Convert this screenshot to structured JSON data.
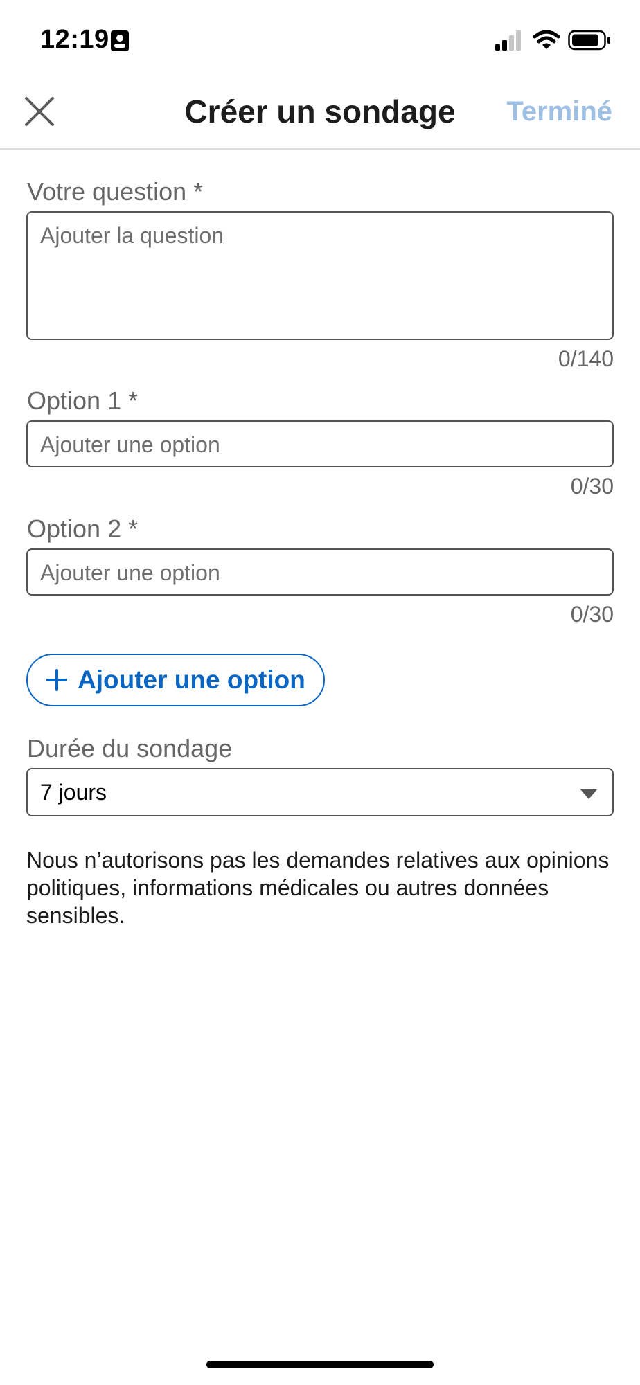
{
  "status_bar": {
    "time": "12:19"
  },
  "header": {
    "title": "Créer un sondage",
    "done_label": "Terminé"
  },
  "question": {
    "label": "Votre question *",
    "placeholder": "Ajouter la question",
    "counter": "0/140"
  },
  "options": [
    {
      "label": "Option 1 *",
      "placeholder": "Ajouter une option",
      "counter": "0/30"
    },
    {
      "label": "Option 2 *",
      "placeholder": "Ajouter une option",
      "counter": "0/30"
    }
  ],
  "add_option_label": "Ajouter une option",
  "duration": {
    "label": "Durée du sondage",
    "value": "7 jours"
  },
  "disclaimer": "Nous n’autorisons pas les demandes relatives aux opinions politiques, informations médicales ou autres données sensibles.",
  "colors": {
    "accent": "#0a66c2",
    "done_disabled": "#9dbfe3",
    "label_gray": "#666666",
    "border": "#555555"
  },
  "icons": {
    "close": "close-icon",
    "add": "plus-icon",
    "dropdown": "caret-down-icon"
  }
}
